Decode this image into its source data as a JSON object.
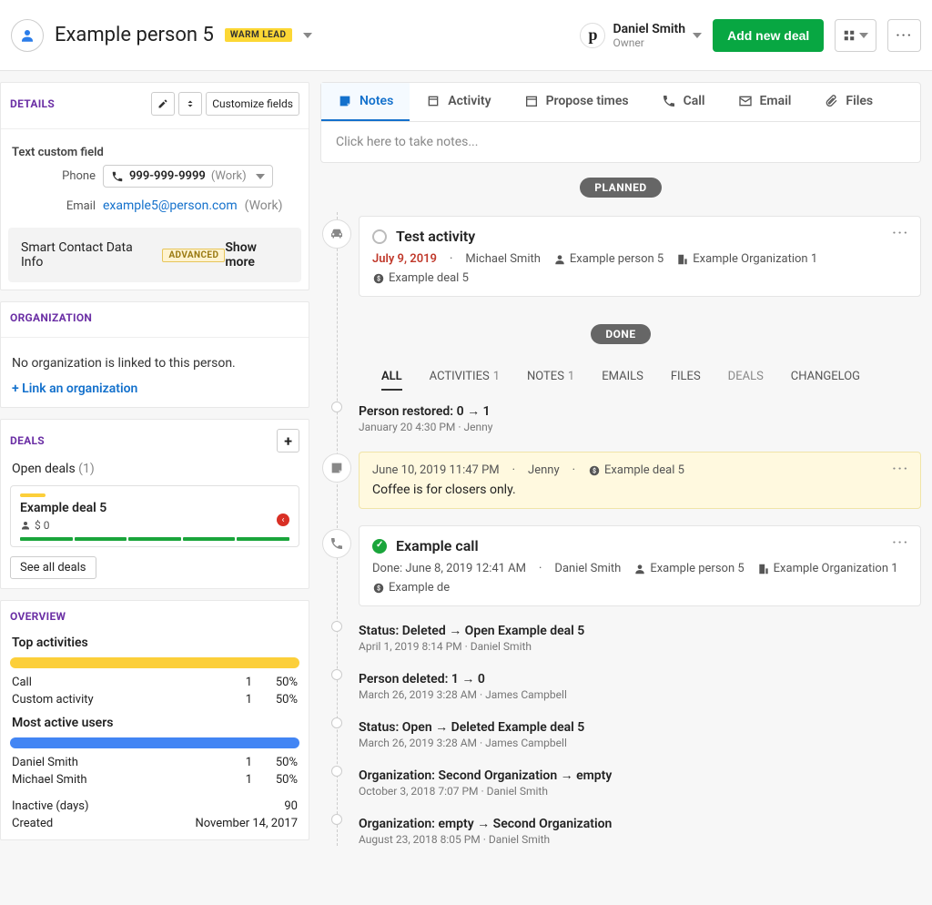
{
  "header": {
    "title": "Example person 5",
    "lead_badge": "WARM LEAD",
    "owner_name": "Daniel Smith",
    "owner_role": "Owner",
    "add_deal": "Add new deal"
  },
  "details": {
    "title": "DETAILS",
    "customize": "Customize fields",
    "custom_field_label": "Text custom field",
    "phone_label": "Phone",
    "phone_value": "999-999-9999",
    "phone_type": "(Work)",
    "email_label": "Email",
    "email_value": "example5@person.com",
    "email_type": "(Work)",
    "smart_label": "Smart Contact Data Info",
    "advanced_badge": "ADVANCED",
    "show_more": "Show more"
  },
  "organization": {
    "title": "ORGANIZATION",
    "empty_text": "No organization is linked to this person.",
    "link_text": "+ Link an organization"
  },
  "deals": {
    "title": "DEALS",
    "open_label": "Open deals",
    "open_count": "(1)",
    "deal_name": "Example deal 5",
    "deal_amount": "$ 0",
    "see_all": "See all deals"
  },
  "overview": {
    "title": "OVERVIEW",
    "top_activities": "Top activities",
    "rows_act": [
      {
        "label": "Call",
        "n": "1",
        "pct": "50%"
      },
      {
        "label": "Custom activity",
        "n": "1",
        "pct": "50%"
      }
    ],
    "most_active": "Most active users",
    "rows_user": [
      {
        "label": "Daniel Smith",
        "n": "1",
        "pct": "50%"
      },
      {
        "label": "Michael Smith",
        "n": "1",
        "pct": "50%"
      }
    ],
    "inactive_label": "Inactive (days)",
    "inactive_value": "90",
    "created_label": "Created",
    "created_value": "November 14, 2017"
  },
  "tabs": [
    "Notes",
    "Activity",
    "Propose times",
    "Call",
    "Email",
    "Files"
  ],
  "notes_placeholder": "Click here to take notes...",
  "planned_pill": "PLANNED",
  "done_pill": "DONE",
  "activity_card": {
    "title": "Test activity",
    "date": "July 9, 2019",
    "by": "Michael Smith",
    "person": "Example person 5",
    "org": "Example Organization 1",
    "deal": "Example deal 5"
  },
  "subtabs": [
    {
      "label": "ALL",
      "count": ""
    },
    {
      "label": "ACTIVITIES",
      "count": "1"
    },
    {
      "label": "NOTES",
      "count": "1"
    },
    {
      "label": "EMAILS",
      "count": ""
    },
    {
      "label": "FILES",
      "count": ""
    },
    {
      "label": "DEALS",
      "count": ""
    },
    {
      "label": "CHANGELOG",
      "count": ""
    }
  ],
  "log1": {
    "title": "Person restored: 0 → 1",
    "meta": "January 20 4:30 PM   ·   Jenny"
  },
  "note": {
    "meta_date": "June 10, 2019 11:47 PM",
    "meta_by": "Jenny",
    "meta_deal": "Example deal 5",
    "text": "Coffee is for closers only."
  },
  "call_card": {
    "title": "Example call",
    "done_prefix": "Done: ",
    "date": "June 8, 2019 12:41 AM",
    "by": "Daniel Smith",
    "person": "Example person 5",
    "org": "Example Organization 1",
    "deal": "Example de"
  },
  "logs": [
    {
      "title": "Status: Deleted → Open  Example deal 5",
      "meta": "April 1, 2019 8:14 PM   ·   Daniel Smith"
    },
    {
      "title": "Person deleted: 1 → 0",
      "meta": "March 26, 2019 3:28 AM   ·   James Campbell"
    },
    {
      "title": "Status: Open → Deleted  Example deal 5",
      "meta": "March 26, 2019 3:28 AM   ·   James Campbell"
    },
    {
      "title": "Organization: Second Organization → empty",
      "meta": "October 3, 2018 7:07 PM   ·   Daniel Smith"
    },
    {
      "title": "Organization: empty → Second Organization",
      "meta": "August 23, 2018 8:05 PM   ·   Daniel Smith"
    }
  ]
}
